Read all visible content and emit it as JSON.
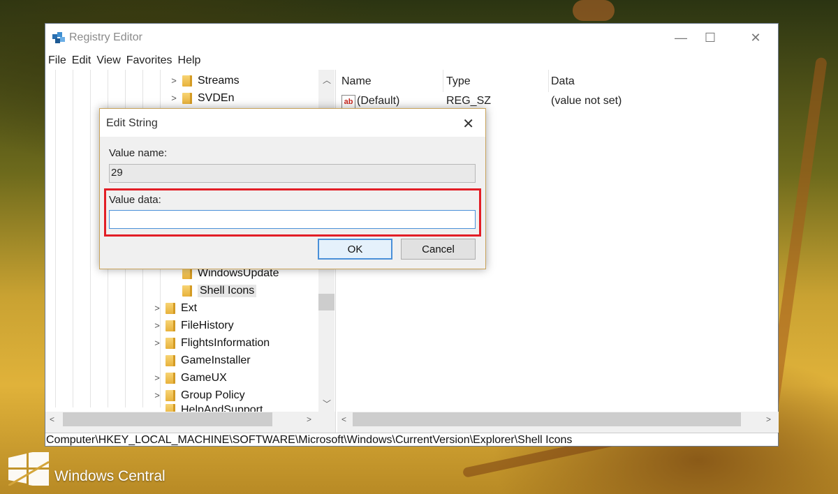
{
  "window": {
    "title": "Registry Editor",
    "controls": {
      "minimize": "—",
      "maximize": "☐",
      "close": "✕"
    }
  },
  "menu": [
    "File",
    "Edit",
    "View",
    "Favorites",
    "Help"
  ],
  "tree": {
    "items": [
      {
        "label": "Streams",
        "expandable": true
      },
      {
        "label": "SVDEn",
        "expandable": true
      },
      {
        "label": "WindowsUpdate",
        "expandable": false
      },
      {
        "label": "Shell Icons",
        "expandable": false,
        "selected": true
      },
      {
        "label": "Ext",
        "expandable": true
      },
      {
        "label": "FileHistory",
        "expandable": true
      },
      {
        "label": "FlightsInformation",
        "expandable": true
      },
      {
        "label": "GameInstaller",
        "expandable": false
      },
      {
        "label": "GameUX",
        "expandable": true
      },
      {
        "label": "Group Policy",
        "expandable": true
      },
      {
        "label": "HelpAndSupport",
        "expandable": false
      }
    ]
  },
  "list": {
    "columns": [
      "Name",
      "Type",
      "Data"
    ],
    "rows": [
      {
        "name": "(Default)",
        "type": "REG_SZ",
        "data": "(value not set)"
      }
    ]
  },
  "status": {
    "path": "Computer\\HKEY_LOCAL_MACHINE\\SOFTWARE\\Microsoft\\Windows\\CurrentVersion\\Explorer\\Shell Icons"
  },
  "dialog": {
    "title": "Edit String",
    "value_name_label": "Value name:",
    "value_name": "29",
    "value_data_label": "Value data:",
    "value_data": "",
    "ok_label": "OK",
    "cancel_label": "Cancel",
    "close": "✕"
  },
  "watermark": {
    "text": "Windows Central"
  },
  "colors": {
    "highlight": "#e21e26",
    "focus": "#4a90d9",
    "folder": "#e8b23c"
  }
}
